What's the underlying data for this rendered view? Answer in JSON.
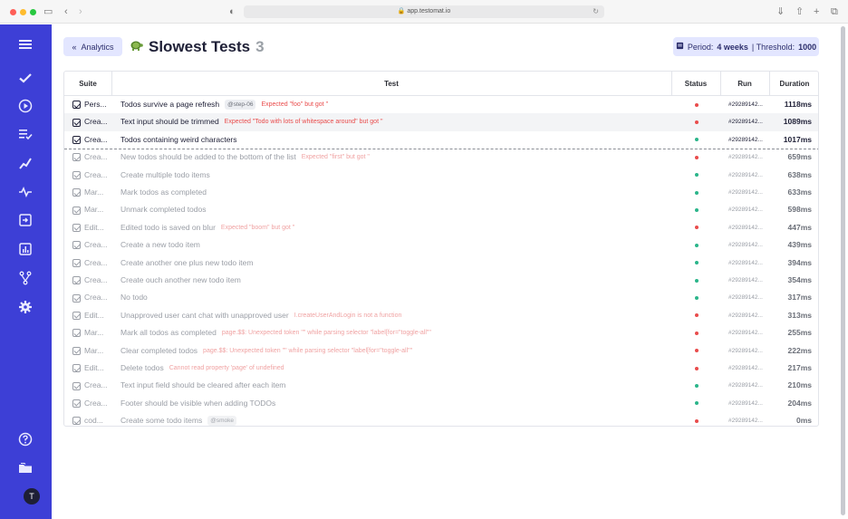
{
  "browser": {
    "url": "app.testomat.io"
  },
  "header": {
    "back_label": "Analytics",
    "title": "Slowest Tests",
    "count": "3",
    "period_prefix": "Period:",
    "period_value": "4 weeks",
    "threshold_prefix": "| Threshold:",
    "threshold_value": "1000"
  },
  "table": {
    "columns": [
      "Suite",
      "Test",
      "Status",
      "Run",
      "Duration"
    ],
    "rows": [
      {
        "suite": "Pers...",
        "test": "Todos survive a page refresh",
        "tag": "@step-06",
        "error": "Expected \"foo\" but got \"",
        "status": "failed",
        "run": "#29289142...",
        "duration": "1118ms"
      },
      {
        "suite": "Crea...",
        "test": "Text input should be trimmed",
        "tag": "",
        "error": "Expected \"Todo with lots of whitespace around\" but got \"",
        "status": "failed",
        "run": "#29289142...",
        "duration": "1089ms"
      },
      {
        "suite": "Crea...",
        "test": "Todos containing weird characters",
        "tag": "",
        "error": "",
        "status": "passed",
        "run": "#29289142...",
        "duration": "1017ms"
      },
      {
        "suite": "Crea...",
        "test": "New todos should be added to the bottom of the list",
        "tag": "",
        "error": "Expected \"first\" but got \"",
        "status": "failed",
        "run": "#29289142...",
        "duration": "659ms"
      },
      {
        "suite": "Crea...",
        "test": "Create multiple todo items",
        "tag": "",
        "error": "",
        "status": "passed",
        "run": "#29289142...",
        "duration": "638ms"
      },
      {
        "suite": "Mar...",
        "test": "Mark todos as completed",
        "tag": "",
        "error": "",
        "status": "passed",
        "run": "#29289142...",
        "duration": "633ms"
      },
      {
        "suite": "Mar...",
        "test": "Unmark completed todos",
        "tag": "",
        "error": "",
        "status": "passed",
        "run": "#29289142...",
        "duration": "598ms"
      },
      {
        "suite": "Edit...",
        "test": "Edited todo is saved on blur",
        "tag": "",
        "error": "Expected \"boom\" but got \"",
        "status": "failed",
        "run": "#29289142...",
        "duration": "447ms"
      },
      {
        "suite": "Crea...",
        "test": "Create a new todo item",
        "tag": "",
        "error": "",
        "status": "passed",
        "run": "#29289142...",
        "duration": "439ms"
      },
      {
        "suite": "Crea...",
        "test": "Create another one plus new todo item",
        "tag": "",
        "error": "",
        "status": "passed",
        "run": "#29289142...",
        "duration": "394ms"
      },
      {
        "suite": "Crea...",
        "test": "Create ouch another new todo item",
        "tag": "",
        "error": "",
        "status": "passed",
        "run": "#29289142...",
        "duration": "354ms"
      },
      {
        "suite": "Crea...",
        "test": "No todo",
        "tag": "",
        "error": "",
        "status": "passed",
        "run": "#29289142...",
        "duration": "317ms"
      },
      {
        "suite": "Edit...",
        "test": "Unapproved user cant chat with unapproved user",
        "tag": "",
        "error": "I.createUserAndLogin is not a function",
        "status": "failed",
        "run": "#29289142...",
        "duration": "313ms"
      },
      {
        "suite": "Mar...",
        "test": "Mark all todos as completed",
        "tag": "",
        "error": "page.$$: Unexpected token \"\" while parsing selector \"label[for=\"toggle-all\"\"",
        "status": "failed",
        "run": "#29289142...",
        "duration": "255ms"
      },
      {
        "suite": "Mar...",
        "test": "Clear completed todos",
        "tag": "",
        "error": "page.$$: Unexpected token \"\" while parsing selector \"label[for=\"toggle-all\"\"",
        "status": "failed",
        "run": "#29289142...",
        "duration": "222ms"
      },
      {
        "suite": "Edit...",
        "test": "Delete todos",
        "tag": "",
        "error": "Cannot read property 'page' of undefined",
        "status": "failed",
        "run": "#29289142...",
        "duration": "217ms"
      },
      {
        "suite": "Crea...",
        "test": "Text input field should be cleared after each item",
        "tag": "",
        "error": "",
        "status": "passed",
        "run": "#29289142...",
        "duration": "210ms"
      },
      {
        "suite": "Crea...",
        "test": "Footer should be visible when adding TODOs",
        "tag": "",
        "error": "",
        "status": "passed",
        "run": "#29289142...",
        "duration": "204ms"
      },
      {
        "suite": "cod...",
        "test": "Create some todo items",
        "tag": "@smoke",
        "error": "",
        "status": "failed",
        "run": "#29289142...",
        "duration": "0ms"
      }
    ]
  },
  "colors": {
    "sidebar": "#3d3fd6",
    "failed": "#e94c4c",
    "passed": "#2bb58a",
    "accent_bg": "#e3e6ff"
  },
  "sidebar_icons": [
    "menu-icon",
    "check-icon",
    "play-icon",
    "runs-list-icon",
    "trend-icon",
    "pulse-icon",
    "import-icon",
    "analytics-icon",
    "branch-icon",
    "settings-icon",
    "help-icon",
    "folder-icon"
  ],
  "user": {
    "avatar_initial": "T"
  }
}
